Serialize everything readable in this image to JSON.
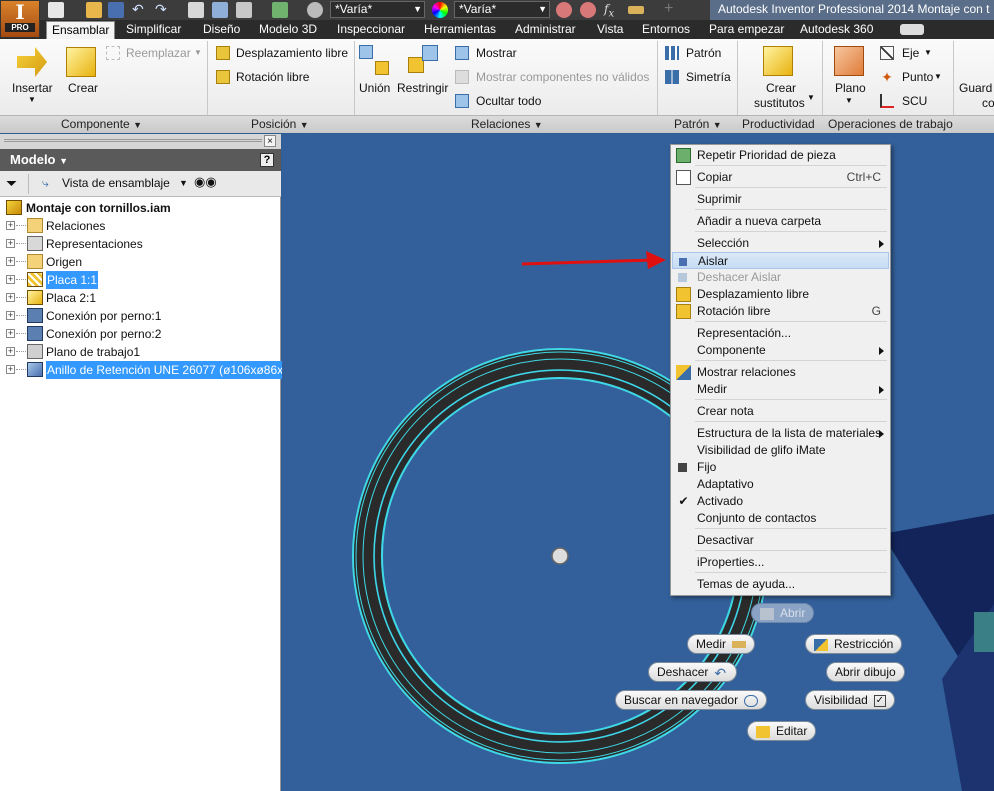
{
  "quick_access": {
    "material_combo": "*Varía*",
    "appearance_combo": "*Varía*"
  },
  "app_title": "Autodesk Inventor Professional 2014   Montaje con t",
  "app_button": {
    "letter": "I",
    "badge": "PRO"
  },
  "tabs": [
    "Ensamblar",
    "Simplificar",
    "Diseño",
    "Modelo 3D",
    "Inspeccionar",
    "Herramientas",
    "Administrar",
    "Vista",
    "Entornos",
    "Para empezar",
    "Autodesk 360"
  ],
  "ribbon": {
    "insertar": "Insertar",
    "crear": "Crear",
    "reemplazar": "Reemplazar",
    "desplazamiento_libre": "Desplazamiento libre",
    "rotacion_libre": "Rotación libre",
    "union": "Unión",
    "restringir": "Restringir",
    "mostrar": "Mostrar",
    "mostrar_no_validos": "Mostrar componentes no válidos",
    "ocultar_todo": "Ocultar todo",
    "patron": "Patrón",
    "simetria": "Simetría",
    "crear_sustitutos_1": "Crear",
    "crear_sustitutos_2": "sustitutos",
    "plano": "Plano",
    "eje": "Eje",
    "punto": "Punto",
    "scu": "SCU",
    "guardar_1": "Guard",
    "guardar_2": "co",
    "panels": [
      "Componente",
      "Posición",
      "Relaciones",
      "Patrón",
      "Productividad",
      "Operaciones de trabajo"
    ]
  },
  "browser": {
    "title": "Modelo",
    "view_combo": "Vista de ensamblaje",
    "root": "Montaje con tornillos.iam",
    "items": [
      {
        "label": "Relaciones",
        "selected": false
      },
      {
        "label": "Representaciones",
        "selected": false
      },
      {
        "label": "Origen",
        "selected": false
      },
      {
        "label": "Placa 1:1",
        "selected": true
      },
      {
        "label": "Placa 2:1",
        "selected": false
      },
      {
        "label": "Conexión por perno:1",
        "selected": false
      },
      {
        "label": "Conexión por perno:2",
        "selected": false
      },
      {
        "label": "Plano de trabajo1",
        "selected": false
      },
      {
        "label": "Anillo de Retención UNE 26077 (ø106xø86x8):1",
        "selected": true
      }
    ]
  },
  "context_menu": [
    {
      "label": "Repetir Prioridad de pieza",
      "shortcut": ""
    },
    {
      "label": "Copiar",
      "shortcut": "Ctrl+C"
    },
    {
      "label": "Suprimir",
      "shortcut": ""
    },
    {
      "label": "Añadir a nueva carpeta",
      "shortcut": ""
    },
    {
      "label": "Selección",
      "shortcut": ""
    },
    {
      "label": "Aislar",
      "shortcut": ""
    },
    {
      "label": "Deshacer Aislar",
      "shortcut": ""
    },
    {
      "label": "Desplazamiento libre",
      "shortcut": ""
    },
    {
      "label": "Rotación libre",
      "shortcut": "G"
    },
    {
      "label": "Representación...",
      "shortcut": ""
    },
    {
      "label": "Componente",
      "shortcut": ""
    },
    {
      "label": "Mostrar relaciones",
      "shortcut": ""
    },
    {
      "label": "Medir",
      "shortcut": ""
    },
    {
      "label": "Crear nota",
      "shortcut": ""
    },
    {
      "label": "Estructura de la lista de materiales",
      "shortcut": ""
    },
    {
      "label": "Visibilidad de glifo iMate",
      "shortcut": ""
    },
    {
      "label": "Fijo",
      "shortcut": ""
    },
    {
      "label": "Adaptativo",
      "shortcut": ""
    },
    {
      "label": "Activado",
      "shortcut": ""
    },
    {
      "label": "Conjunto de contactos",
      "shortcut": ""
    },
    {
      "label": "Desactivar",
      "shortcut": ""
    },
    {
      "label": "iProperties...",
      "shortcut": ""
    },
    {
      "label": "Temas de ayuda...",
      "shortcut": ""
    }
  ],
  "marking_menu": {
    "abrir": "Abrir",
    "medir": "Medir",
    "restriccion": "Restricción",
    "deshacer": "Deshacer",
    "abrir_dibujo": "Abrir dibujo",
    "buscar": "Buscar en navegador",
    "visibilidad": "Visibilidad",
    "editar": "Editar"
  },
  "colors": {
    "viewport_bg": "#33609a",
    "ring_edge": "#3fd9e6",
    "ring_body": "#2a2a2a",
    "selection": "#3399ff",
    "arrow": "#e01010"
  }
}
